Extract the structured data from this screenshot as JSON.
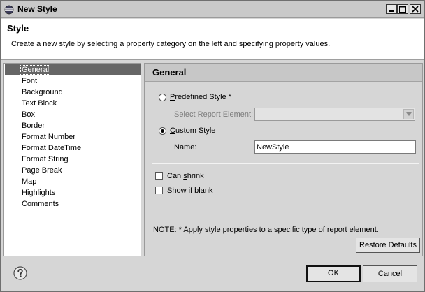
{
  "window": {
    "title": "New Style",
    "icon": "eclipse-icon"
  },
  "header": {
    "title": "Style",
    "description": "Create a new style by selecting a property category on the left and specifying property values."
  },
  "categories": [
    {
      "label": "General",
      "selected": true
    },
    {
      "label": "Font"
    },
    {
      "label": "Background"
    },
    {
      "label": "Text Block"
    },
    {
      "label": "Box"
    },
    {
      "label": "Border"
    },
    {
      "label": "Format Number"
    },
    {
      "label": "Format DateTime"
    },
    {
      "label": "Format String"
    },
    {
      "label": "Page Break"
    },
    {
      "label": "Map"
    },
    {
      "label": "Highlights"
    },
    {
      "label": "Comments"
    }
  ],
  "panel": {
    "title": "General",
    "predefined_style": {
      "label_mnemonic": "P",
      "label_rest": "redefined Style *",
      "checked": false
    },
    "select_report_element": {
      "label": "Select Report Element:",
      "value": "",
      "enabled": false
    },
    "custom_style": {
      "label_mnemonic": "C",
      "label_rest": "ustom Style",
      "checked": true
    },
    "name": {
      "label": "Name:",
      "value": "NewStyle"
    },
    "can_shrink": {
      "label_pre": "Can ",
      "label_mnemonic": "s",
      "label_rest": "hrink",
      "checked": false
    },
    "show_if_blank": {
      "label_pre": "Sho",
      "label_mnemonic": "w",
      "label_rest": " if blank",
      "checked": false
    },
    "note": "NOTE: * Apply style properties to a specific type of report element.",
    "restore_defaults_label": "Restore Defaults"
  },
  "footer": {
    "ok_label": "OK",
    "cancel_label": "Cancel",
    "help_icon": "help-icon"
  }
}
